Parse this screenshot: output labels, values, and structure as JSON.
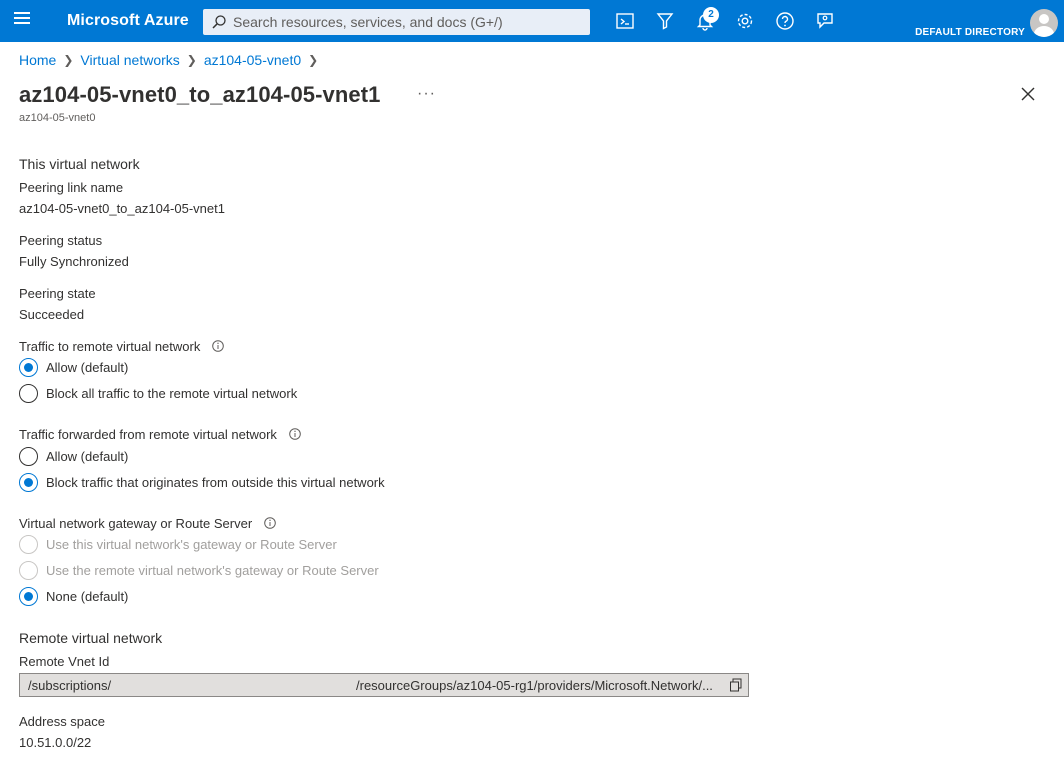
{
  "topbar": {
    "brand": "Microsoft Azure",
    "search_placeholder": "Search resources, services, and docs (G+/)",
    "notification_count": "2",
    "directory": "DEFAULT DIRECTORY"
  },
  "breadcrumb": [
    "Home",
    "Virtual networks",
    "az104-05-vnet0"
  ],
  "page": {
    "title": "az104-05-vnet0_to_az104-05-vnet1",
    "ellipsis": "···",
    "subtitle": "az104-05-vnet0"
  },
  "this_vnet": {
    "section_title": "This virtual network",
    "peering_link_label": "Peering link name",
    "peering_link_value": "az104-05-vnet0_to_az104-05-vnet1",
    "peering_status_label": "Peering status",
    "peering_status_value": "Fully Synchronized",
    "peering_state_label": "Peering state",
    "peering_state_value": "Succeeded"
  },
  "traffic_to_remote": {
    "label": "Traffic to remote virtual network",
    "options": [
      {
        "label": "Allow (default)",
        "checked": true
      },
      {
        "label": "Block all traffic to the remote virtual network",
        "checked": false
      }
    ]
  },
  "traffic_forwarded": {
    "label": "Traffic forwarded from remote virtual network",
    "options": [
      {
        "label": "Allow (default)",
        "checked": false
      },
      {
        "label": "Block traffic that originates from outside this virtual network",
        "checked": true
      }
    ]
  },
  "gateway": {
    "label": "Virtual network gateway or Route Server",
    "options": [
      {
        "label": "Use this virtual network's gateway or Route Server",
        "checked": false,
        "disabled": true
      },
      {
        "label": "Use the remote virtual network's gateway or Route Server",
        "checked": false,
        "disabled": true
      },
      {
        "label": "None (default)",
        "checked": true,
        "disabled": false
      }
    ]
  },
  "remote_vnet": {
    "section_title": "Remote virtual network",
    "vnet_id_label": "Remote Vnet Id",
    "vnet_id_left": "/subscriptions/",
    "vnet_id_right": "/resourceGroups/az104-05-rg1/providers/Microsoft.Network/...",
    "address_space_label": "Address space",
    "address_space_value": "10.51.0.0/22"
  },
  "colors": {
    "accent": "#0078d4",
    "text": "#323130",
    "disabled": "#a19f9d"
  }
}
